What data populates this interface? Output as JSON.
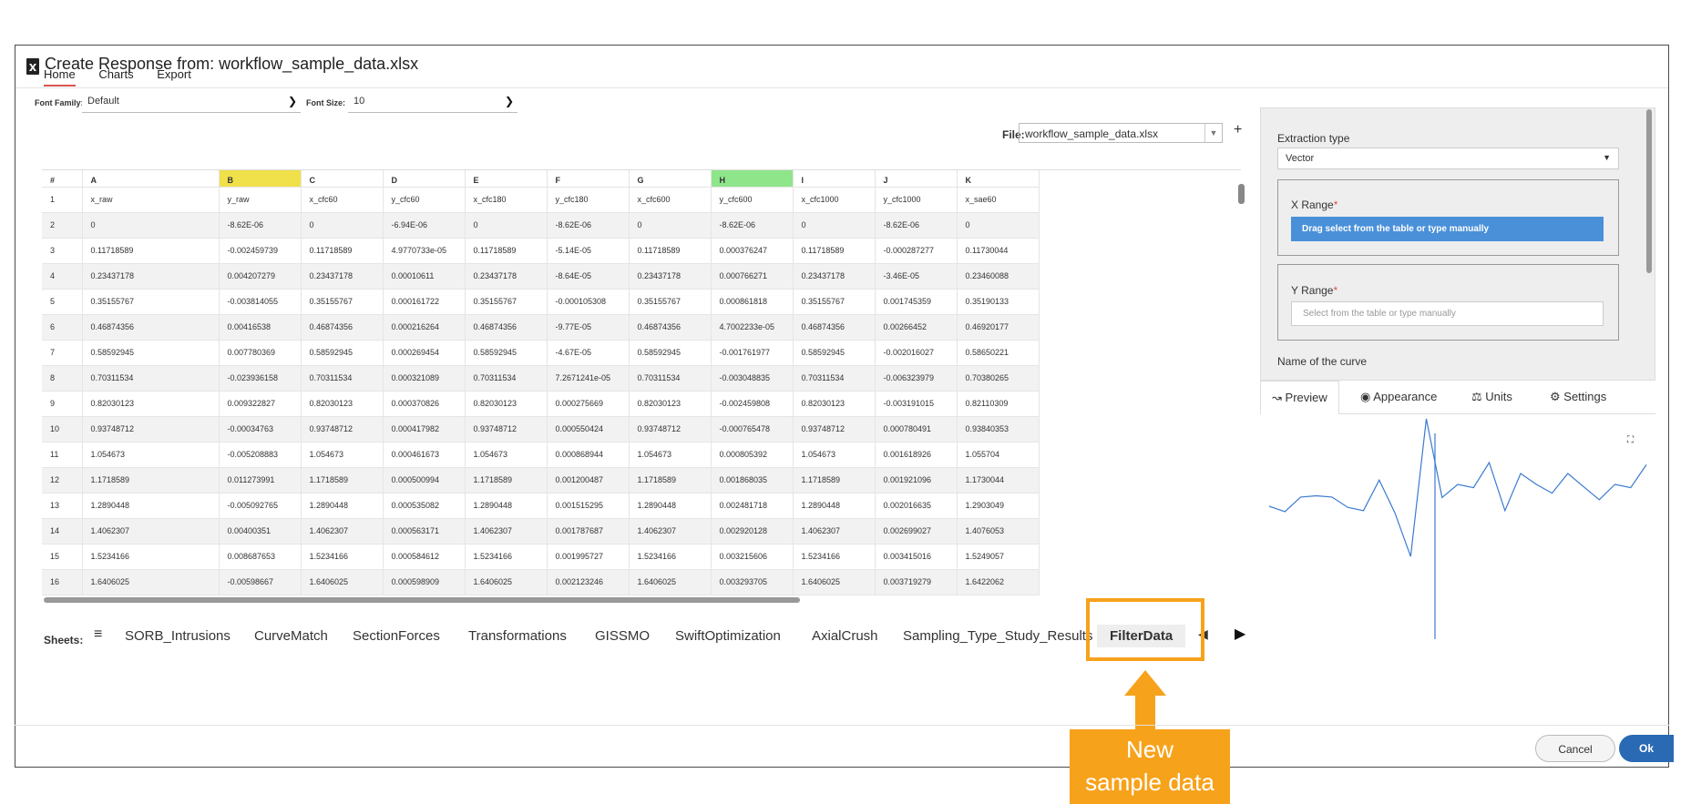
{
  "title": "Create Response from: workflow_sample_data.xlsx",
  "toolbar_tabs": [
    "Home",
    "Charts",
    "Export"
  ],
  "font": {
    "family_label": "Font Family:",
    "family_value": "Default",
    "size_label": "Font Size:",
    "size_value": "10"
  },
  "file": {
    "label": "File:",
    "value": "workflow_sample_data.xlsx"
  },
  "grid": {
    "columns": [
      "#",
      "A",
      "B",
      "C",
      "D",
      "E",
      "F",
      "G",
      "H",
      "I",
      "J",
      "K"
    ],
    "highlight": {
      "B": "#f0e04a",
      "H": "#8ee58a"
    },
    "rows": [
      [
        "1",
        "x_raw",
        "y_raw",
        "x_cfc60",
        "y_cfc60",
        "x_cfc180",
        "y_cfc180",
        "x_cfc600",
        "y_cfc600",
        "x_cfc1000",
        "y_cfc1000",
        "x_sae60"
      ],
      [
        "2",
        "0",
        "-8.62E-06",
        "0",
        "-6.94E-06",
        "0",
        "-8.62E-06",
        "0",
        "-8.62E-06",
        "0",
        "-8.62E-06",
        "0"
      ],
      [
        "3",
        "0.11718589",
        "-0.002459739",
        "0.11718589",
        "4.9770733e-05",
        "0.11718589",
        "-5.14E-05",
        "0.11718589",
        "0.000376247",
        "0.11718589",
        "-0.000287277",
        "0.11730044"
      ],
      [
        "4",
        "0.23437178",
        "0.004207279",
        "0.23437178",
        "0.00010611",
        "0.23437178",
        "-8.64E-05",
        "0.23437178",
        "0.000766271",
        "0.23437178",
        "-3.46E-05",
        "0.23460088"
      ],
      [
        "5",
        "0.35155767",
        "-0.003814055",
        "0.35155767",
        "0.000161722",
        "0.35155767",
        "-0.000105308",
        "0.35155767",
        "0.000861818",
        "0.35155767",
        "0.001745359",
        "0.35190133"
      ],
      [
        "6",
        "0.46874356",
        "0.00416538",
        "0.46874356",
        "0.000216264",
        "0.46874356",
        "-9.77E-05",
        "0.46874356",
        "4.7002233e-05",
        "0.46874356",
        "0.00266452",
        "0.46920177"
      ],
      [
        "7",
        "0.58592945",
        "0.007780369",
        "0.58592945",
        "0.000269454",
        "0.58592945",
        "-4.67E-05",
        "0.58592945",
        "-0.001761977",
        "0.58592945",
        "-0.002016027",
        "0.58650221"
      ],
      [
        "8",
        "0.70311534",
        "-0.023936158",
        "0.70311534",
        "0.000321089",
        "0.70311534",
        "7.2671241e-05",
        "0.70311534",
        "-0.003048835",
        "0.70311534",
        "-0.006323979",
        "0.70380265"
      ],
      [
        "9",
        "0.82030123",
        "0.009322827",
        "0.82030123",
        "0.000370826",
        "0.82030123",
        "0.000275669",
        "0.82030123",
        "-0.002459808",
        "0.82030123",
        "-0.003191015",
        "0.82110309"
      ],
      [
        "10",
        "0.93748712",
        "-0.00034763",
        "0.93748712",
        "0.000417982",
        "0.93748712",
        "0.000550424",
        "0.93748712",
        "-0.000765478",
        "0.93748712",
        "0.000780491",
        "0.93840353"
      ],
      [
        "11",
        "1.054673",
        "-0.005208883",
        "1.054673",
        "0.000461673",
        "1.054673",
        "0.000868944",
        "1.054673",
        "0.000805392",
        "1.054673",
        "0.001618926",
        "1.055704"
      ],
      [
        "12",
        "1.1718589",
        "0.011273991",
        "1.1718589",
        "0.000500994",
        "1.1718589",
        "0.001200487",
        "1.1718589",
        "0.001868035",
        "1.1718589",
        "0.001921096",
        "1.1730044"
      ],
      [
        "13",
        "1.2890448",
        "-0.005092765",
        "1.2890448",
        "0.000535082",
        "1.2890448",
        "0.001515295",
        "1.2890448",
        "0.002481718",
        "1.2890448",
        "0.002016635",
        "1.2903049"
      ],
      [
        "14",
        "1.4062307",
        "0.00400351",
        "1.4062307",
        "0.000563171",
        "1.4062307",
        "0.001787687",
        "1.4062307",
        "0.002920128",
        "1.4062307",
        "0.002699027",
        "1.4076053"
      ],
      [
        "15",
        "1.5234166",
        "0.008687653",
        "1.5234166",
        "0.000584612",
        "1.5234166",
        "0.001995727",
        "1.5234166",
        "0.003215606",
        "1.5234166",
        "0.003415016",
        "1.5249057"
      ],
      [
        "16",
        "1.6406025",
        "-0.00598667",
        "1.6406025",
        "0.000598909",
        "1.6406025",
        "0.002123246",
        "1.6406025",
        "0.003293705",
        "1.6406025",
        "0.003719279",
        "1.6422062"
      ]
    ]
  },
  "sheets": {
    "label": "Sheets:",
    "items": [
      "SORB_Intrusions",
      "CurveMatch",
      "SectionForces",
      "Transformations",
      "GISSMO",
      "SwiftOptimization",
      "AxialCrush",
      "Sampling_Type_Study_Results",
      "FilterData"
    ],
    "active": "FilterData"
  },
  "callout": {
    "line1": "New",
    "line2": "sample data",
    "color": "#f7a21b"
  },
  "side": {
    "extraction_label": "Extraction type",
    "extraction_value": "Vector",
    "x_range_label": "X Range",
    "x_range_button": "Drag select from the table or type manually",
    "y_range_label": "Y Range",
    "y_range_placeholder": "Select from the table or type manually",
    "curve_name_label": "Name of the curve",
    "required_mark": "*"
  },
  "panel_tabs": [
    "Preview",
    "Appearance",
    "Units",
    "Settings"
  ],
  "preview_series": [
    0.0,
    -0.0025,
    0.0042,
    0.0048,
    0.0042,
    -0.0005,
    -0.002,
    0.012,
    -0.003,
    -0.023,
    0.04,
    0.004,
    0.01,
    0.0085,
    0.02,
    -0.002,
    0.015,
    0.01,
    0.006,
    0.015,
    0.009,
    0.003,
    0.01,
    0.0085,
    0.019
  ],
  "footer": {
    "cancel": "Cancel",
    "ok": "Ok"
  },
  "colors": {
    "accent": "#2a6ab4",
    "tab_underline": "#d9534f",
    "select_blue": "#4a90d9"
  }
}
